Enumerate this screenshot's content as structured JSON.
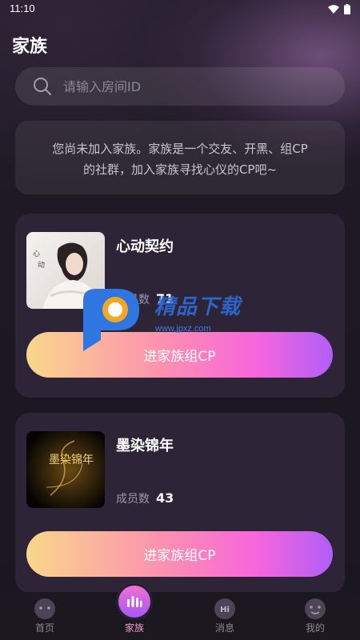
{
  "status_bar": {
    "time": "11:10"
  },
  "page_title": "家族",
  "search": {
    "placeholder": "请输入房间ID"
  },
  "notice": {
    "line1": "您尚未加入家族。家族是一个交友、开黑、组CP",
    "line2": "的社群，加入家族寻找心仪的CP吧~"
  },
  "families": [
    {
      "name": "心动契约",
      "member_label": "成员数",
      "member_count": "71",
      "join_label": "进家族组CP",
      "cover_icon": "woman-photo"
    },
    {
      "name": "墨染锦年",
      "member_label": "成员数",
      "member_count": "43",
      "join_label": "进家族组CP",
      "cover_icon": "gold-calligraphy",
      "cover_text": "墨染锦年"
    }
  ],
  "watermark": {
    "text": "精品下载",
    "url": "www.jpxz.com"
  },
  "tabs": [
    {
      "label": "首页",
      "icon": "home-face-icon",
      "active": false
    },
    {
      "label": "家族",
      "icon": "family-bars-icon",
      "active": true
    },
    {
      "label": "消息",
      "icon": "message-hi-icon",
      "active": false,
      "icon_text": "Hi"
    },
    {
      "label": "我的",
      "icon": "profile-face-icon",
      "active": false
    }
  ],
  "colors": {
    "background": "#1f1a24",
    "card": "#2e2438",
    "button_gradient_start": "#fad78a",
    "button_gradient_end": "#b15ef7",
    "tab_active": "#f09dd0"
  }
}
